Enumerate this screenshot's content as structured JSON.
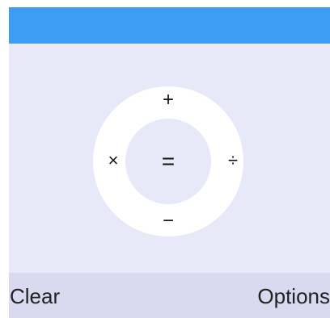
{
  "colors": {
    "title_bar": "#3d9df5",
    "background": "#e7e8f8",
    "dpad_ring": "#ffffff",
    "softkey_bar": "#d9daef"
  },
  "dpad": {
    "center_label": "=",
    "up_label": "+",
    "down_label": "−",
    "left_label": "×",
    "right_label": "÷"
  },
  "softkeys": {
    "left_label": "Clear",
    "right_label": "Options"
  }
}
